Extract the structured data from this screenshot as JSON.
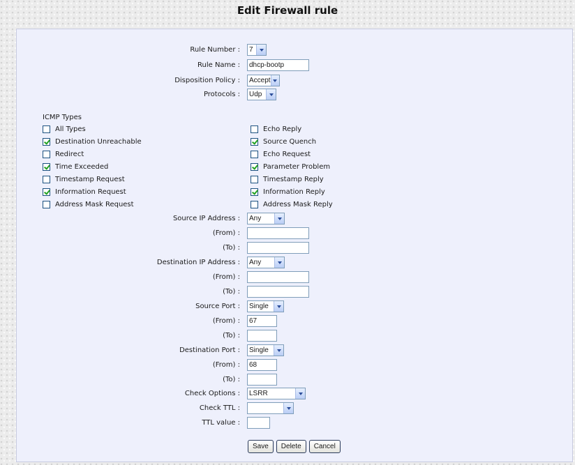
{
  "title": "Edit Firewall rule",
  "rule_number": {
    "label": "Rule Number :",
    "value": "7"
  },
  "rule_name": {
    "label": "Rule Name :",
    "value": "dhcp-bootp"
  },
  "disposition": {
    "label": "Disposition Policy :",
    "value": "Accept"
  },
  "protocols": {
    "label": "Protocols :",
    "value": "Udp"
  },
  "icmp": {
    "title": "ICMP Types",
    "left": [
      {
        "label": "All Types",
        "checked": false
      },
      {
        "label": "Destination Unreachable",
        "checked": true
      },
      {
        "label": "Redirect",
        "checked": false
      },
      {
        "label": "Time Exceeded",
        "checked": true
      },
      {
        "label": "Timestamp Request",
        "checked": false
      },
      {
        "label": "Information Request",
        "checked": true
      },
      {
        "label": "Address Mask Request",
        "checked": false
      }
    ],
    "right": [
      {
        "label": "Echo Reply",
        "checked": false
      },
      {
        "label": "Source Quench",
        "checked": true
      },
      {
        "label": "Echo Request",
        "checked": false
      },
      {
        "label": "Parameter Problem",
        "checked": true
      },
      {
        "label": "Timestamp Reply",
        "checked": false
      },
      {
        "label": "Information Reply",
        "checked": true
      },
      {
        "label": "Address Mask Reply",
        "checked": false
      }
    ]
  },
  "source_ip": {
    "label": "Source IP Address :",
    "value": "Any",
    "from_label": "(From) :",
    "from_value": "",
    "to_label": "(To) :",
    "to_value": ""
  },
  "dest_ip": {
    "label": "Destination IP Address :",
    "value": "Any",
    "from_label": "(From) :",
    "from_value": "",
    "to_label": "(To) :",
    "to_value": ""
  },
  "source_port": {
    "label": "Source Port :",
    "value": "Single",
    "from_label": "(From) :",
    "from_value": "67",
    "to_label": "(To) :",
    "to_value": ""
  },
  "dest_port": {
    "label": "Destination Port :",
    "value": "Single",
    "from_label": "(From) :",
    "from_value": "68",
    "to_label": "(To) :",
    "to_value": ""
  },
  "check_options": {
    "label": "Check Options :",
    "value": "LSRR"
  },
  "check_ttl": {
    "label": "Check TTL :",
    "value": ""
  },
  "ttl_value": {
    "label": "TTL value :",
    "value": ""
  },
  "buttons": {
    "save": "Save",
    "delete": "Delete",
    "cancel": "Cancel"
  }
}
